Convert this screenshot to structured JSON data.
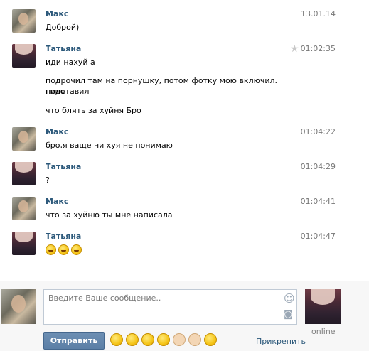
{
  "messages": [
    {
      "author": "Макс",
      "time": "13.01.14",
      "lines": [
        "Доброй)"
      ]
    },
    {
      "author": "Татьяна",
      "time": "01:02:35",
      "starred": true,
      "lines": [
        "иди нахуй а",
        "подрочил там на порнушку, потом фотку мою включил. типо",
        "подставил",
        "что блять за хуйня Бро"
      ]
    },
    {
      "author": "Макс",
      "time": "01:04:22",
      "lines": [
        "бро,я ваще ни хуя не понимаю"
      ]
    },
    {
      "author": "Татьяна",
      "time": "01:04:29",
      "lines": [
        "?"
      ]
    },
    {
      "author": "Макс",
      "time": "01:04:41",
      "lines": [
        "что за хуйню ты мне написала"
      ]
    },
    {
      "author": "Татьяна",
      "time": "01:04:47",
      "emoji_count": 3
    }
  ],
  "composer": {
    "placeholder": "Введите Ваше сообщение..",
    "send_label": "Отправить",
    "attach_label": "Прикрепить",
    "partner_status": "online",
    "emoji_icons": [
      "smile-icon",
      "laugh-icon",
      "squint-icon",
      "wink-icon",
      "thumbs-up-icon",
      "thumbs-down-icon",
      "surprised-icon"
    ]
  },
  "colors": {
    "author": "#2b587a",
    "time": "#777777",
    "send_button": "#5b7fa6",
    "link": "#2b587a"
  }
}
